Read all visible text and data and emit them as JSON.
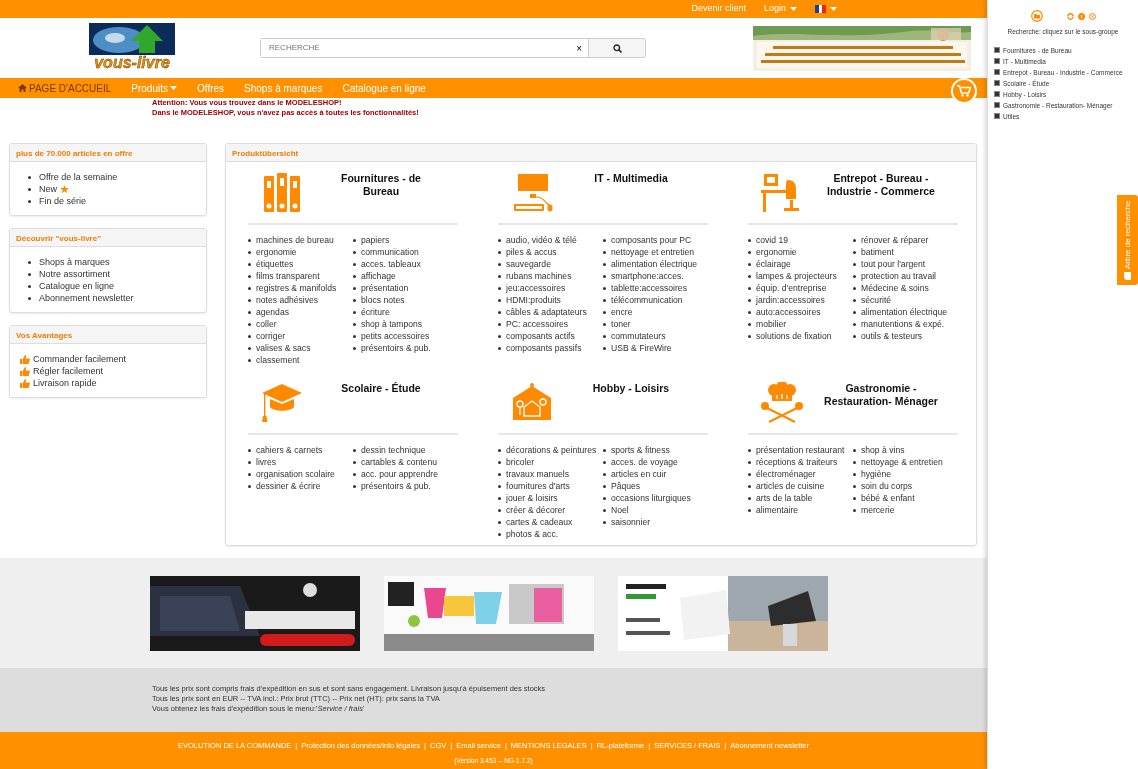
{
  "topbar": {
    "links": [
      {
        "label": "Devenir client",
        "kind": "link"
      },
      {
        "label": "Login",
        "kind": "dropdown"
      }
    ],
    "language": {
      "kind": "dropdown"
    }
  },
  "header": {
    "logo": "vous-livre",
    "search": {
      "placeholder": "RECHERCHE",
      "clear": "×"
    },
    "banner": {
      "kind": "picture"
    }
  },
  "nav": {
    "items": [
      {
        "label": "PAGE D'ACCUEIL",
        "kind": "home",
        "selected": true
      },
      {
        "label": "Produits",
        "kind": "dropdown",
        "selected": false
      },
      {
        "label": "Offres",
        "kind": "link",
        "selected": false
      },
      {
        "label": "Shops à marques",
        "kind": "link",
        "selected": false
      },
      {
        "label": "Catalogue en ligne",
        "kind": "link",
        "selected": false
      }
    ]
  },
  "notice": [
    "Attention: Vous vous trouvez dans le MODELESHOP!",
    "Dans le MODELESHOP, vous n'avez pas accès à toutes les fonctionnalités!"
  ],
  "side_panels": [
    {
      "title": "plus de 70.000 articles en offre",
      "items": [
        {
          "label": "Offre de la semaine",
          "kind": "bullet",
          "starred": false
        },
        {
          "label": "New",
          "kind": "bullet",
          "starred": true
        },
        {
          "label": "Fin de série",
          "kind": "bullet",
          "starred": false
        }
      ]
    },
    {
      "title": "Découvrir \"vous-livre\"",
      "items": [
        {
          "label": "Shops à marques",
          "kind": "bullet",
          "starred": false
        },
        {
          "label": "Notre assortiment",
          "kind": "bullet",
          "starred": false
        },
        {
          "label": "Catalogue en ligne",
          "kind": "bullet",
          "starred": false
        },
        {
          "label": "Abonnement newsletter",
          "kind": "bullet",
          "starred": false
        }
      ]
    },
    {
      "title": "Vos Avantages",
      "items": [
        {
          "label": "Commander facilement",
          "kind": "thumb",
          "starred": false
        },
        {
          "label": "Régler facilement",
          "kind": "thumb",
          "starred": false
        },
        {
          "label": "Livraison rapide",
          "kind": "thumb",
          "starred": false
        }
      ]
    }
  ],
  "overview": {
    "title": "Produktübersicht",
    "categories": [
      {
        "title": "Fournitures - de Bureau",
        "left": [
          "machines de bureau",
          "ergonomie",
          "étiquettes",
          "films transparent",
          "registres & manifolds",
          "notes adhésives",
          "agendas",
          "coller",
          "corriger",
          "valises & sacs",
          "classement"
        ],
        "right": [
          "papiers",
          "communication",
          "acces. tableaux",
          "affichage",
          "présentation",
          "blocs notes",
          "écriture",
          "shop à tampons",
          "petits accessoires",
          "présentoirs & pub."
        ]
      },
      {
        "title": "IT - Multimedia",
        "left": [
          "audio, vidéo & télé",
          "piles & accus",
          "sauvegarde",
          "rubans machines",
          "jeu:accessoires",
          "HDMI:produits",
          "câbles & adaptateurs",
          "PC: accessoires",
          "composants actifs",
          "composants passifs"
        ],
        "right": [
          "composants pour PC",
          "nettoyage et entretien",
          "alimentation électrique",
          "smartphone:acces.",
          "tablette:accessoires",
          "télécommunication",
          "encre",
          "toner",
          "commutateurs",
          "USB & FireWire"
        ]
      },
      {
        "title": "Entrepot - Bureau - Industrie - Commerce",
        "left": [
          "covid 19",
          "ergonomie",
          "éclairage",
          "lampes & projecteurs",
          "équip. d'entreprise",
          "jardin:accessoires",
          "auto:accessoires",
          "mobilier",
          "solutions de fixation"
        ],
        "right": [
          "rénover & réparer",
          "batiment",
          "tout pour l'argent",
          "protection au travail",
          "Médecine & soins",
          "sécurité",
          "alimentation électrique",
          "manutentions & expé.",
          "outils & testeurs"
        ]
      },
      {
        "title": "Scolaire - Étude",
        "left": [
          "cahiers & carnets",
          "livres",
          "organisation scolaire",
          "dessiner & écrire"
        ],
        "right": [
          "dessin technique",
          "cartables & contenu",
          "acc. pour apprendre",
          "présentoirs & pub."
        ]
      },
      {
        "title": "Hobby - Loisirs",
        "left": [
          "décorations & peintures",
          "bricoler",
          "travaux manuels",
          "fournitures d'arts",
          "jouer & loisirs",
          "créer & décorer",
          "cartes & cadeaux",
          "photos & acc."
        ],
        "right": [
          "sports & fitness",
          "acces. de voyage",
          "articles en cuir",
          "Pâques",
          "occasions liturgiques",
          "Noel",
          "saisonnier"
        ]
      },
      {
        "title": "Gastronomie - Restauration- Ménager",
        "left": [
          "présentation restaurant",
          "réceptions & traiteurs",
          "électroménager",
          "articles de cuisine",
          "arts de la table",
          "alimentaire"
        ],
        "right": [
          "shop à vins",
          "nettoyage & entretien",
          "hygiène",
          "soin du corps",
          "bébé & enfant",
          "mercerie"
        ]
      }
    ]
  },
  "banners": [
    {
      "kind": "picture"
    },
    {
      "kind": "picture"
    },
    {
      "kind": "picture"
    }
  ],
  "footer": {
    "notes": [
      "Tous les prix sont compris frais d'expédition en sus et sont sans engagement. Livraison jusqu'à épuisement des stocks",
      "Tous les prix sont en EUR -- TVA incl.: Prix brut (TTC) -- Prix net (HT): prix sans la TVA",
      "Vous obtenez les frais d'expédition sous le menu:'*Service / frais*'"
    ],
    "links": [
      "EVOLUTION DE LA COMMANDE",
      "Protection des données/info légales",
      "CGV",
      "Email service",
      "MENTIONS LEGALES",
      "RL-plateforme",
      "SERVICES / FRAIS",
      "Abonnement newsletter"
    ],
    "separator": "|",
    "version": "(Version 3.453 -- NG-1.7.2)"
  },
  "search_tree": {
    "caption": "Recherche: cliquez sur le sous-groupe",
    "items": [
      {
        "label": "Fournitures - de Bureau",
        "expanded": false
      },
      {
        "label": "IT - Multimedia",
        "expanded": false
      },
      {
        "label": "Entrepot - Bureau - Industrie - Commerce",
        "expanded": false
      },
      {
        "label": "Scolaire - Étude",
        "expanded": false
      },
      {
        "label": "Hobby - Loisirs",
        "expanded": false
      },
      {
        "label": "Gastronomie - Restauration- Ménager",
        "expanded": false
      },
      {
        "label": "Utiles",
        "expanded": false
      }
    ],
    "tab": "Arbre de recherche"
  }
}
